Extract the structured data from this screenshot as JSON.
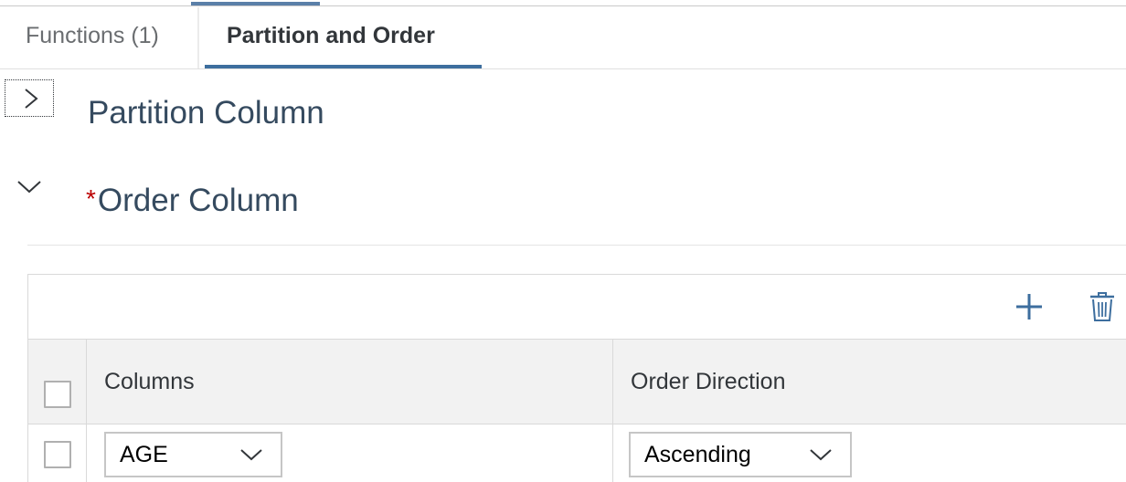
{
  "tabs": [
    {
      "label": "Functions (1)",
      "selected": false
    },
    {
      "label": "Partition and Order",
      "selected": true
    }
  ],
  "sections": {
    "partition": {
      "title": "Partition Column",
      "expanded": false,
      "expander_icon": "chevron-right-icon"
    },
    "order": {
      "title": "Order Column",
      "required_marker": "*",
      "expanded": true,
      "expander_icon": "chevron-down-icon"
    }
  },
  "toolbar": {
    "add_icon": "plus-icon",
    "delete_icon": "trash-icon"
  },
  "table": {
    "headers": {
      "columns": "Columns",
      "order_direction": "Order Direction"
    },
    "rows": [
      {
        "column": "AGE",
        "order_direction": "Ascending",
        "selected": false
      }
    ]
  },
  "colors": {
    "accent": "#3d6e9e",
    "title": "#354a5f",
    "required": "#bb0000",
    "header_bg": "#f2f2f2"
  }
}
